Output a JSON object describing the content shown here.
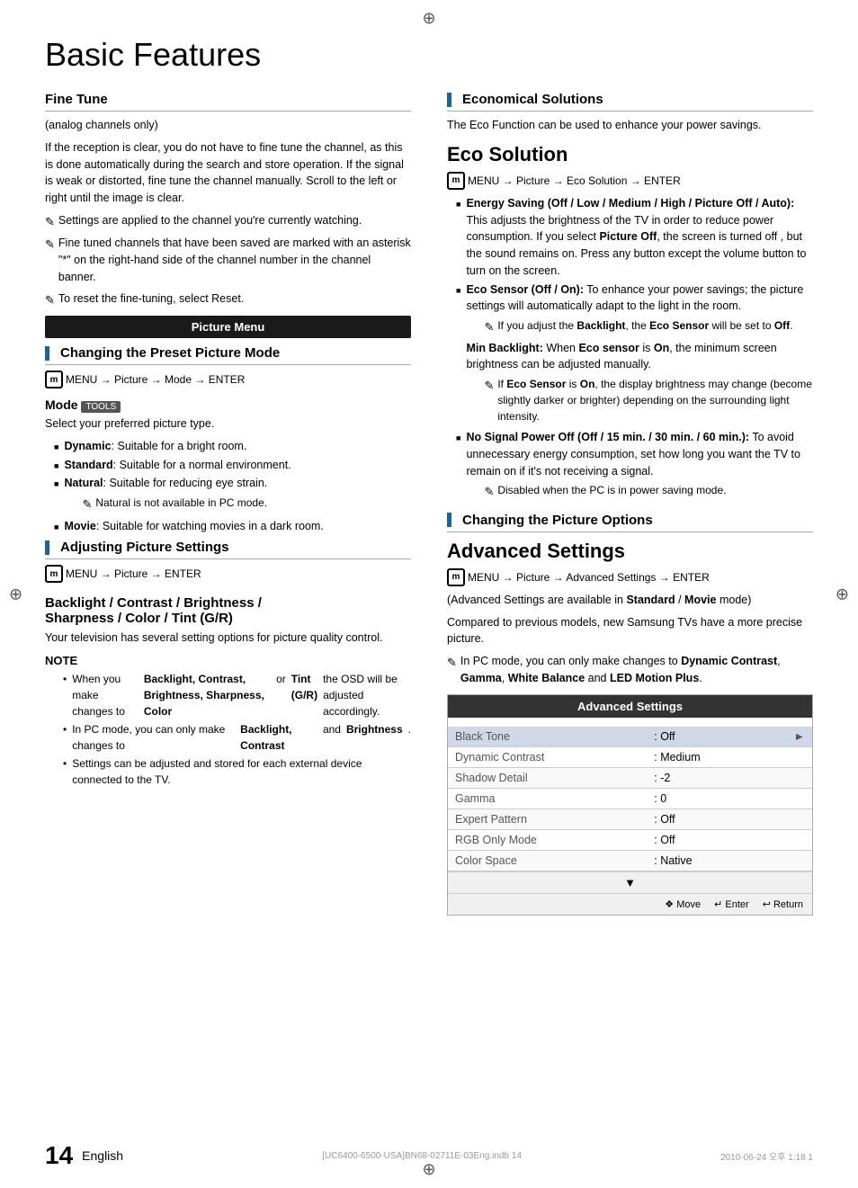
{
  "page": {
    "title": "Basic Features",
    "footer_page_num": "14",
    "footer_lang": "English",
    "footer_doc": "[UC6400-6500-USA]BN68-02711E-03Eng.indb   14",
    "footer_date": "2010-06-24   오후 1:18   1"
  },
  "left_col": {
    "fine_tune": {
      "heading": "Fine Tune",
      "sub": "(analog channels only)",
      "body1": "If the reception is clear, you do not have to fine tune the channel, as this is done automatically during the search and store operation. If the signal is weak or distorted, fine tune the channel manually. Scroll to the left or right until the image is clear.",
      "note1": "Settings are applied to the channel you're currently watching.",
      "note2": "Fine tuned channels that have been saved are marked with an asterisk \"*\" on the right-hand side of the channel number in the channel banner.",
      "note3": "To reset the fine-tuning, select Reset."
    },
    "picture_menu_box": "Picture Menu",
    "changing_preset": {
      "heading": "Changing the Preset Picture Mode",
      "menu_path": "MENU  → Picture → Mode → ENTER"
    },
    "mode": {
      "heading": "Mode",
      "tools_label": "TOOLS",
      "sub": "Select your preferred picture type.",
      "items": [
        {
          "label": "Dynamic",
          "desc": "Suitable for a bright room."
        },
        {
          "label": "Standard",
          "desc": "Suitable for a normal environment."
        },
        {
          "label": "Natural",
          "desc": "Suitable for reducing eye strain.",
          "note": "Natural is not available in PC mode."
        },
        {
          "label": "Movie",
          "desc": "Suitable for watching movies in a dark room."
        }
      ]
    },
    "adjusting": {
      "heading": "Adjusting Picture Settings",
      "menu_path": "MENU  → Picture → ENTER"
    },
    "backlight": {
      "heading": "Backlight / Contrast / Brightness / Sharpness / Color / Tint (G/R)",
      "body": "Your television has several setting options for picture quality control.",
      "note_header": "NOTE",
      "bullets": [
        "When you make changes to Backlight, Contrast, Brightness, Sharpness, Color or Tint (G/R) the OSD will be adjusted accordingly.",
        "In PC mode, you can only make changes to Backlight, Contrast and Brightness.",
        "Settings can be adjusted and stored for each external device connected to the TV."
      ]
    }
  },
  "right_col": {
    "eco": {
      "heading": "Economical Solutions",
      "body": "The Eco Function can be used to enhance your power savings.",
      "eco_solution_heading": "Eco Solution",
      "menu_path": "MENU  → Picture → Eco Solution → ENTER",
      "items": [
        {
          "label": "Energy Saving (Off / Low / Medium / High / Picture Off / Auto):",
          "desc": "This adjusts the brightness of the TV in order to reduce power consumption. If you select Picture Off, the screen is turned off , but the sound remains on. Press any button except the volume button to turn on the screen."
        },
        {
          "label": "Eco Sensor (Off / On):",
          "desc": "To enhance your power savings; the picture settings will automatically adapt to the light in the room.",
          "note": "If you adjust the Backlight, the Eco Sensor will be set to Off.",
          "sub_heading": "Min Backlight:",
          "sub_desc": "When Eco sensor is On, the minimum screen brightness can be adjusted manually.",
          "sub_note": "If Eco Sensor is On, the display brightness may change (become slightly darker or brighter) depending on the surrounding light intensity."
        },
        {
          "label": "No Signal Power Off (Off / 15 min. / 30 min. / 60 min.):",
          "desc": "To avoid unnecessary energy consumption, set how long you want the TV to remain on if it's not receiving a signal.",
          "note": "Disabled when the PC is in power saving mode."
        }
      ]
    },
    "changing_options": {
      "heading": "Changing the Picture Options"
    },
    "advanced": {
      "heading": "Advanced Settings",
      "menu_path": "MENU  → Picture → Advanced Settings → ENTER",
      "body1": "(Advanced Settings are available in Standard / Movie mode)",
      "body2": "Compared to previous models, new Samsung TVs have a more precise picture.",
      "note": "In PC mode, you can only make changes to Dynamic Contrast, Gamma, White Balance and LED Motion Plus.",
      "table_heading": "Advanced Settings",
      "table_rows": [
        {
          "label": "Black Tone",
          "value": ": Off",
          "arrow": "►",
          "highlight": true
        },
        {
          "label": "Dynamic Contrast",
          "value": ": Medium",
          "arrow": ""
        },
        {
          "label": "Shadow Detail",
          "value": ": -2",
          "arrow": ""
        },
        {
          "label": "Gamma",
          "value": ": 0",
          "arrow": ""
        },
        {
          "label": "Expert Pattern",
          "value": ": Off",
          "arrow": ""
        },
        {
          "label": "RGB Only Mode",
          "value": ": Off",
          "arrow": ""
        },
        {
          "label": "Color Space",
          "value": ": Native",
          "arrow": ""
        }
      ],
      "table_footer": {
        "scroll_indicator": "▼",
        "move_label": "Move",
        "enter_label": "Enter",
        "return_label": "Return"
      }
    }
  }
}
